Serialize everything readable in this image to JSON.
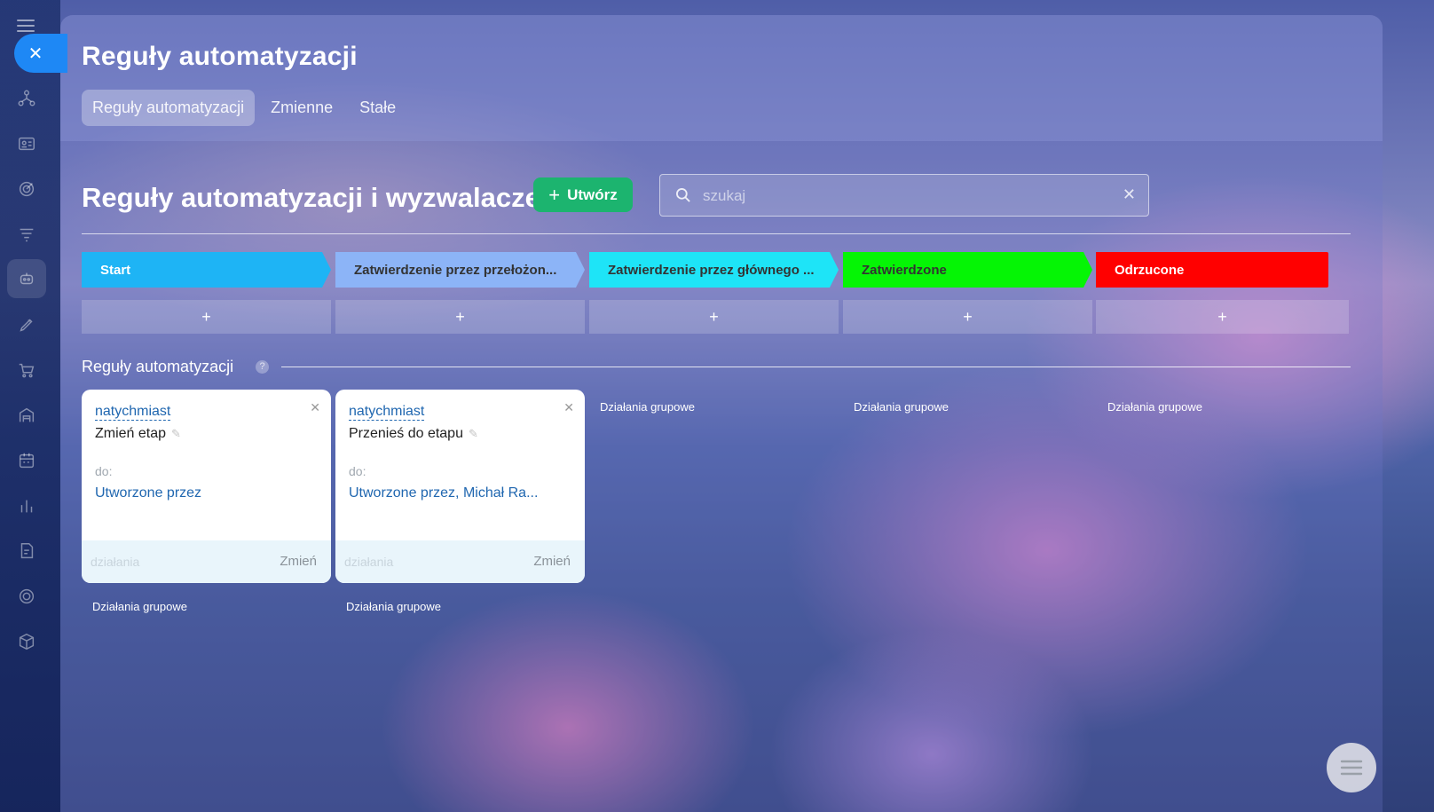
{
  "rail": {
    "close_icon": "close-icon"
  },
  "panel": {
    "title": "Reguły automatyzacji",
    "tabs": [
      {
        "label": "Reguły automatyzacji",
        "active": true
      },
      {
        "label": "Zmienne",
        "active": false
      },
      {
        "label": "Stałe",
        "active": false
      }
    ]
  },
  "section": {
    "title": "Reguły automatyzacji i wyzwalacze",
    "create_label": "Utwórz",
    "search_placeholder": "szukaj"
  },
  "stages": [
    {
      "label": "Start",
      "color": "#1eb4f5"
    },
    {
      "label": "Zatwierdzenie przez przełożon...",
      "color": "#8cb4f7"
    },
    {
      "label": "Zatwierdzenie przez głównego ...",
      "color": "#1ee4f7"
    },
    {
      "label": "Zatwierdzone",
      "color": "#05f505"
    },
    {
      "label": "Odrzucone",
      "color": "#ff0000"
    }
  ],
  "add_symbol": "+",
  "rules": {
    "title": "Reguły automatyzacji",
    "help": "?",
    "cards": [
      {
        "trigger": "natychmiast",
        "action": "Zmień etap",
        "to_label": "do:",
        "to_value": "Utworzone przez",
        "foot_left": "działania",
        "foot_right": "Zmień"
      },
      {
        "trigger": "natychmiast",
        "action": "Przenieś do etapu",
        "to_label": "do:",
        "to_value": "Utworzone przez, Michał Ra...",
        "foot_left": "działania",
        "foot_right": "Zmień"
      }
    ],
    "group_actions": "Działania grupowe"
  }
}
